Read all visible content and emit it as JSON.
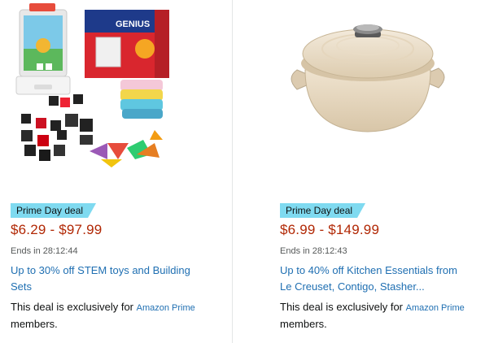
{
  "deals": [
    {
      "image": "Osmo Genius Starter Kit STEM toy with tablet stand and colorful tiles",
      "badge": "Prime Day deal",
      "price": "$6.29 - $97.99",
      "ends": "Ends in 28:12:44",
      "title": "Up to 30% off STEM toys and Building Sets",
      "exclusive_prefix": "This deal is exclusively for",
      "exclusive_link": "Amazon Prime",
      "exclusive_suffix": "members."
    },
    {
      "image": "Cream enameled cast iron Dutch oven with lid",
      "badge": "Prime Day deal",
      "price": "$6.99 - $149.99",
      "ends": "Ends in 28:12:43",
      "title": "Up to 40% off Kitchen Essentials from Le Creuset, Contigo, Stasher...",
      "exclusive_prefix": "This deal is exclusively for",
      "exclusive_link": "Amazon Prime",
      "exclusive_suffix": "members."
    }
  ],
  "colors": {
    "badge_bg": "#7fdaf0",
    "price": "#b12704",
    "link": "#1f6fb2",
    "muted": "#565959"
  }
}
